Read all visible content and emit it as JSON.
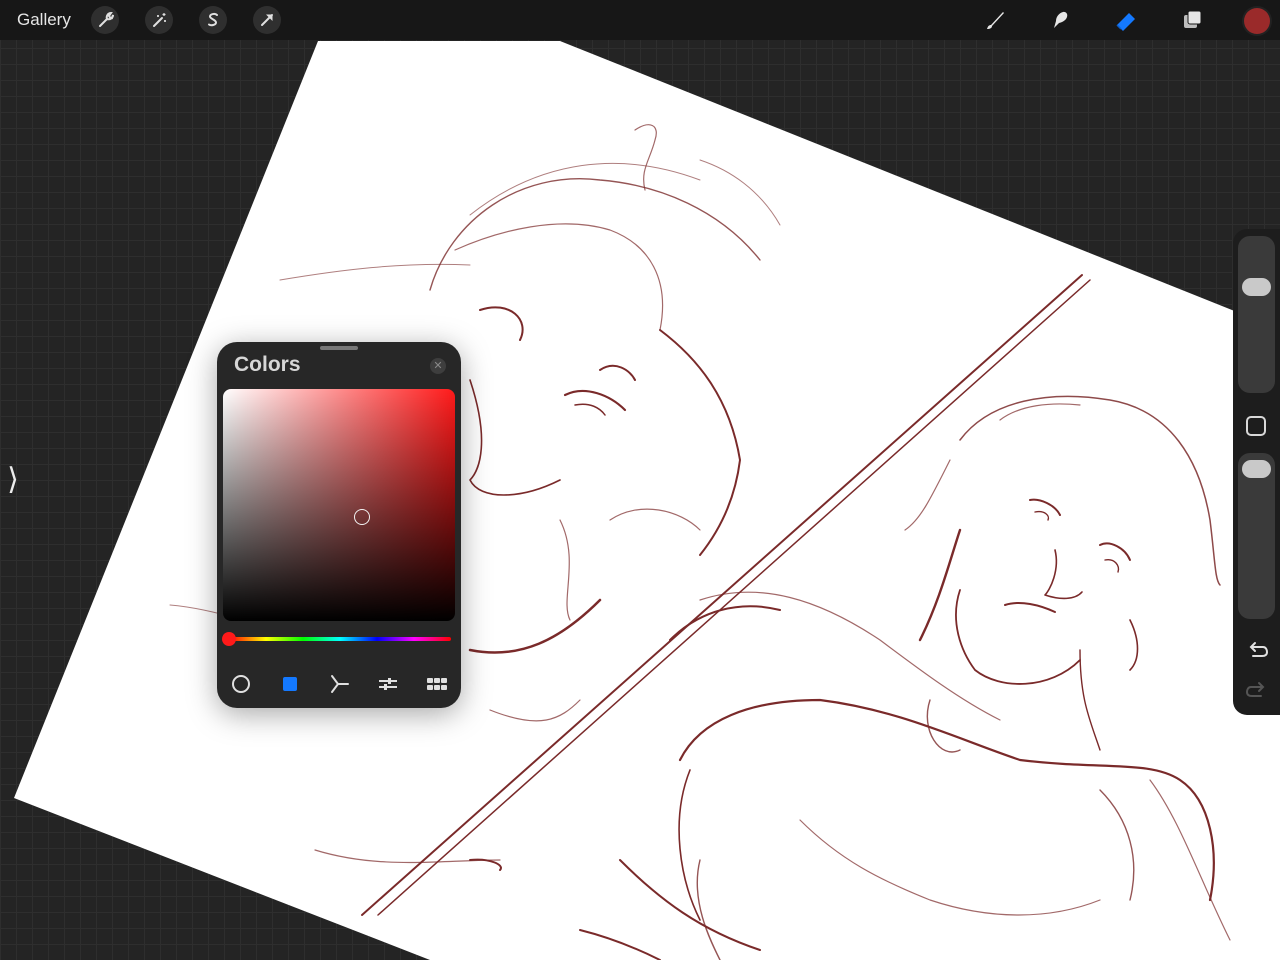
{
  "toolbar": {
    "gallery_label": "Gallery",
    "left_icons": [
      "wrench-icon",
      "magic-wand-icon",
      "selection-s-icon",
      "transform-arrow-icon"
    ],
    "right_icons": [
      "brush-icon",
      "smudge-icon",
      "eraser-icon",
      "layers-icon"
    ],
    "active_tool": "eraser",
    "current_color": "#9a2a2a"
  },
  "colors_panel": {
    "title": "Colors",
    "close_icon": "close-icon",
    "hue_color": "#ff1a1a",
    "saturation": 0.6,
    "value": 0.45,
    "hue_position": 0.0,
    "modes": [
      "disc-mode-icon",
      "classic-mode-icon",
      "harmony-mode-icon",
      "value-mode-icon",
      "palettes-mode-icon"
    ],
    "active_mode": "classic-mode-icon"
  },
  "sidebar": {
    "brush_size_level": 0.7,
    "opacity_level": 0.95,
    "icons": [
      "modify-square-icon",
      "undo-icon",
      "redo-icon"
    ]
  },
  "colors": {
    "accent_blue": "#1479ff",
    "sketch_line": "#7a2a2a"
  }
}
